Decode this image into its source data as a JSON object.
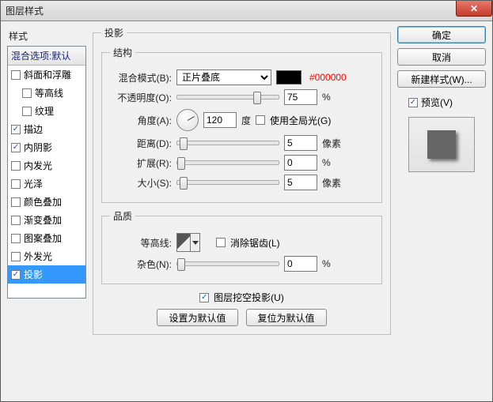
{
  "window": {
    "title": "图层样式"
  },
  "left": {
    "header_label": "样式",
    "blend_options": "混合选项:默认",
    "items": [
      {
        "label": "斜面和浮雕",
        "checked": false,
        "indent": false
      },
      {
        "label": "等高线",
        "checked": false,
        "indent": true
      },
      {
        "label": "纹理",
        "checked": false,
        "indent": true
      },
      {
        "label": "描边",
        "checked": true,
        "indent": false
      },
      {
        "label": "内阴影",
        "checked": true,
        "indent": false
      },
      {
        "label": "内发光",
        "checked": false,
        "indent": false
      },
      {
        "label": "光泽",
        "checked": false,
        "indent": false
      },
      {
        "label": "颜色叠加",
        "checked": false,
        "indent": false
      },
      {
        "label": "渐变叠加",
        "checked": false,
        "indent": false
      },
      {
        "label": "图案叠加",
        "checked": false,
        "indent": false
      },
      {
        "label": "外发光",
        "checked": false,
        "indent": false
      },
      {
        "label": "投影",
        "checked": true,
        "indent": false,
        "selected": true
      }
    ]
  },
  "panel": {
    "title": "投影",
    "structure": {
      "legend": "结构",
      "blend_mode_label": "混合模式(B):",
      "blend_mode_value": "正片叠底",
      "color": "#000000",
      "hex_text": "#000000",
      "opacity_label": "不透明度(O):",
      "opacity_value": "75",
      "pct": "%",
      "angle_label": "角度(A):",
      "angle_value": "120",
      "angle_unit": "度",
      "global_light_label": "使用全局光(G)",
      "global_light_checked": false,
      "distance_label": "距离(D):",
      "distance_value": "5",
      "px": "像素",
      "spread_label": "扩展(R):",
      "spread_value": "0",
      "size_label": "大小(S):",
      "size_value": "5"
    },
    "quality": {
      "legend": "品质",
      "contour_label": "等高线:",
      "antialias_label": "消除锯齿(L)",
      "antialias_checked": false,
      "noise_label": "杂色(N):",
      "noise_value": "0",
      "pct": "%"
    },
    "knockout_label": "图层挖空投影(U)",
    "knockout_checked": true,
    "btn_default": "设置为默认值",
    "btn_reset": "复位为默认值"
  },
  "right": {
    "ok": "确定",
    "cancel": "取消",
    "new_style": "新建样式(W)...",
    "preview_label": "预览(V)",
    "preview_checked": true
  }
}
